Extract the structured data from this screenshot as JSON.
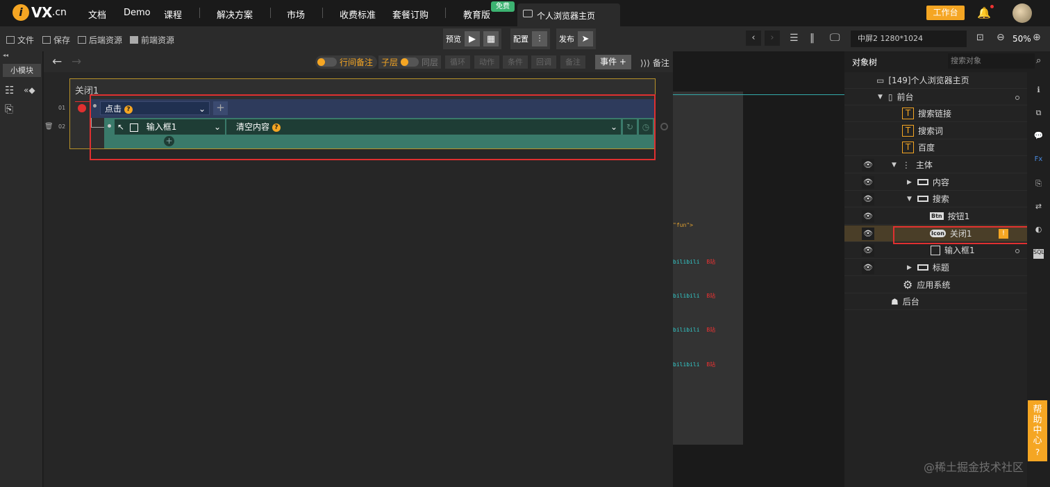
{
  "brand": {
    "logo_letter": "i",
    "logo_text": "VX",
    "logo_suffix": ".cn"
  },
  "nav": {
    "items": [
      "文档",
      "Demo",
      "课程",
      "解决方案",
      "市场",
      "收费标准",
      "套餐订购",
      "教育版"
    ],
    "free_badge": "免费",
    "tab_label": "个人浏览器主页"
  },
  "header": {
    "workbench": "工作台"
  },
  "toolbar": {
    "file": "文件",
    "save": "保存",
    "backend": "后端资源",
    "frontend": "前端资源",
    "preview": "预览",
    "config": "配置",
    "publish": "发布",
    "screen": "中屏2 1280*1024",
    "zoom": "50%"
  },
  "left": {
    "small_module": "小模块"
  },
  "editor": {
    "toggles": {
      "inline_note": "行间备注",
      "child_layer": "子层",
      "same_layer": "同层"
    },
    "dim_buttons": [
      "循环",
      "动作",
      "条件",
      "回调",
      "备注"
    ],
    "event_btn": "事件 +",
    "note_btn": "备注",
    "block_title": "关闭1",
    "row_nums": [
      "01",
      "02"
    ],
    "trigger": "点击",
    "target": "输入框1",
    "action": "清空内容"
  },
  "preview_texts": [
    "\"fun\">",
    "bilibili",
    "B站",
    "bilibili",
    "B站",
    "bilibili",
    "B站",
    "bilibili",
    "B站"
  ],
  "tree": {
    "title": "对象树",
    "search_placeholder": "搜索对象",
    "root": "[149]个人浏览器主页",
    "front": "前台",
    "link": "搜索链接",
    "word": "搜索词",
    "baidu": "百度",
    "body": "主体",
    "content": "内容",
    "search": "搜索",
    "button1": "按钮1",
    "close1": "关闭1",
    "input1": "输入框1",
    "heading": "标题",
    "appsys": "应用系统",
    "backend": "后台",
    "btn_tag": "Btn",
    "icon_tag": "Icon"
  },
  "help": {
    "text": "帮助中心",
    "q": "?"
  },
  "watermark": "@稀土掘金技术社区",
  "colors": {
    "accent": "#f5a623",
    "red_outline": "#e03030",
    "row_blue": "#2e3b5c",
    "row_green": "#3a7a6a"
  }
}
